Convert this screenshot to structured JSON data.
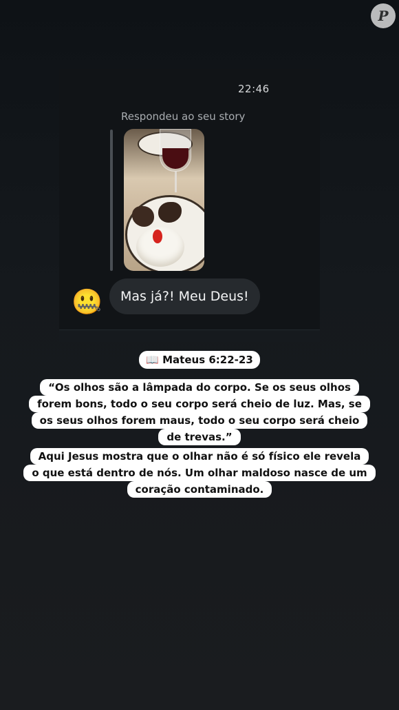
{
  "watermark": "P",
  "dm": {
    "time": "22:46",
    "reply_label": "Respondeu ao seu story",
    "message": "Mas já?! Meu Deus!",
    "sender_emoji": "🤐"
  },
  "captions": {
    "reference": "📖 Mateus 6:22-23",
    "verse_lines": [
      "“Os olhos são a lâmpada do corpo. Se os seus olhos",
      "forem bons, todo o seu corpo será cheio de luz. Mas, se",
      "os seus olhos forem maus, todo o seu corpo será cheio",
      "de trevas.”"
    ],
    "explain_lines": [
      "Aqui Jesus mostra que o olhar não é só físico ele revela",
      "o que está dentro de nós. Um olhar maldoso nasce de um",
      "coração contaminado."
    ]
  }
}
